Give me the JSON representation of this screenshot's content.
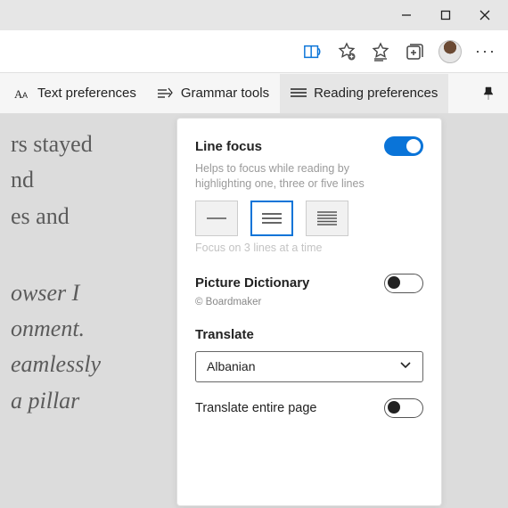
{
  "tabs": {
    "text_prefs": "Text preferences",
    "grammar": "Grammar tools",
    "reading": "Reading preferences"
  },
  "content": {
    "p1_l1": "rs stayed",
    "p1_l2": "nd",
    "p1_l3": "es and",
    "p2_l1": "owser I",
    "p2_l2": "onment.",
    "p2_l3": "eamlessly",
    "p2_l4": "a pillar"
  },
  "panel": {
    "line_focus": {
      "title": "Line focus",
      "desc": "Helps to focus while reading by highlighting one, three or five lines",
      "hint": "Focus on 3 lines at a time",
      "enabled": true,
      "selected": 1
    },
    "picture_dict": {
      "title": "Picture Dictionary",
      "credit": "© Boardmaker",
      "enabled": false
    },
    "translate": {
      "title": "Translate",
      "value": "Albanian"
    },
    "translate_page": {
      "title": "Translate entire page",
      "enabled": false
    }
  }
}
